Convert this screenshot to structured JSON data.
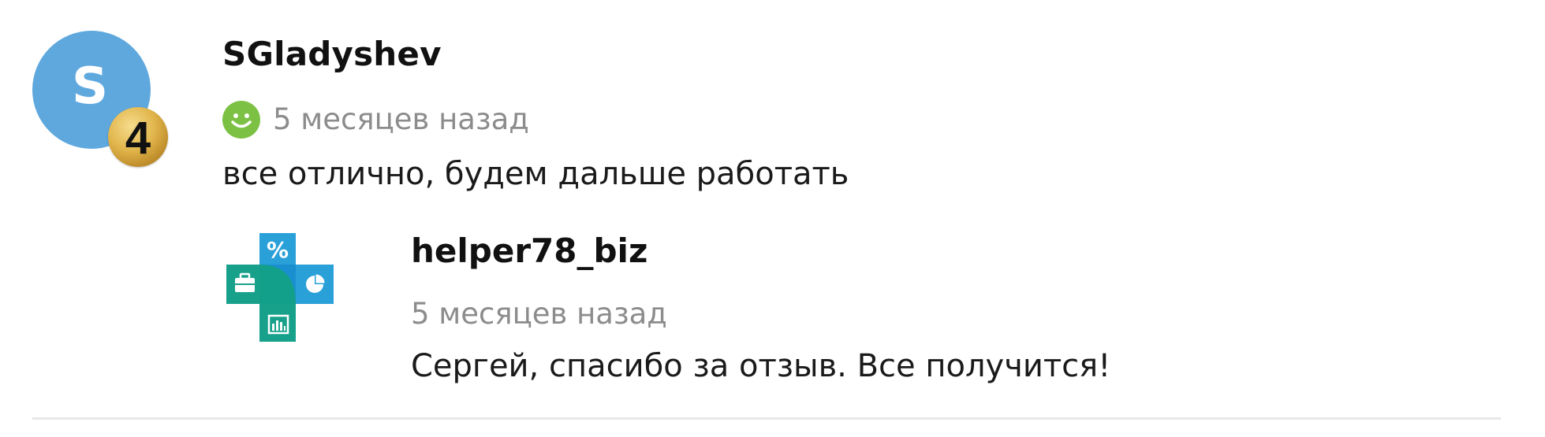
{
  "review": {
    "author": {
      "avatar_letter": "S",
      "avatar_color": "#5fa8de",
      "level": "4",
      "name": "SGladyshev"
    },
    "rating_icon": "smiley-positive-icon",
    "rating_color": "#7cc144",
    "date": "5 месяцев назад",
    "text": "все отлично, будем дальше работать"
  },
  "reply": {
    "logo_icon": "business-cross-logo-icon",
    "logo_colors": [
      "#2aa0d8",
      "#17a18b",
      "#0f8a78"
    ],
    "name": "helper78_biz",
    "date": "5 месяцев назад",
    "text": "Сергей, спасибо за отзыв.  Все получится!"
  }
}
